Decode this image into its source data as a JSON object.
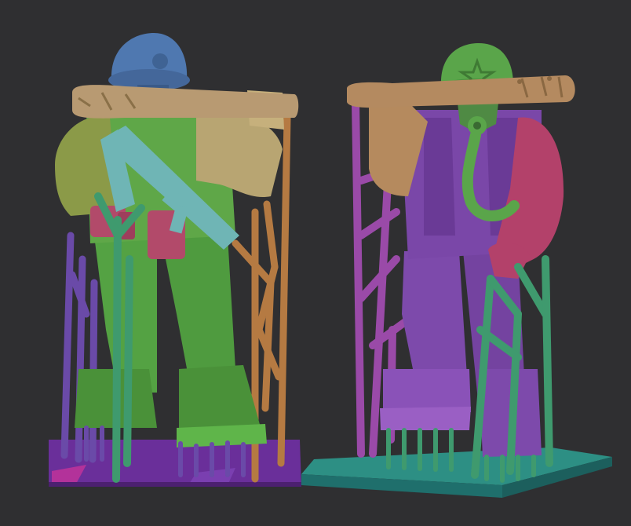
{
  "scene": {
    "background": "#2f2f31",
    "figures": [
      {
        "id": "soldier-back-view",
        "palette": {
          "helmet": "#4f78b0",
          "bat": "#b89a72",
          "torso": "#5fa748",
          "arm": "#b8a572",
          "rifle": "#6fb5b5",
          "pouches": "#b24a6a",
          "legs": "#54a243",
          "supports_left": "#6a4aa8",
          "supports_right": "#b57a42",
          "supports_front": "#3f9a6e",
          "base": "#6a2f9a",
          "base_accent": "#c0339a"
        }
      },
      {
        "id": "soldier-gas-mask",
        "palette": {
          "helmet": "#5aa54a",
          "bat": "#b48a60",
          "torso": "#7a47a8",
          "arm_left": "#b58a5e",
          "arm_right": "#b3416a",
          "mask": "#5aa54a",
          "legs": "#7d4aab",
          "supports_left": "#9a4aa8",
          "supports_right": "#3f9a6e",
          "base": "#2d8f84",
          "base_side": "#1f6f6c"
        }
      }
    ]
  }
}
